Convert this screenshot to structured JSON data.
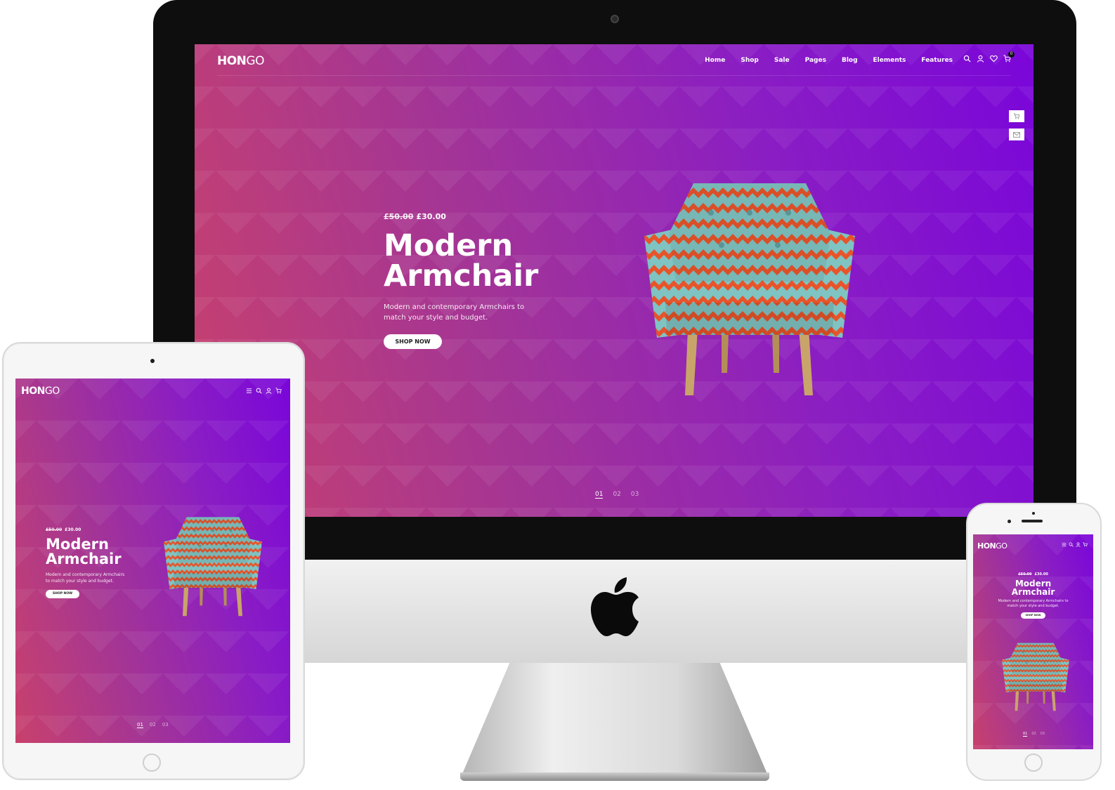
{
  "brand": {
    "logo_bold": "HON",
    "logo_light": "GO"
  },
  "nav": {
    "items": [
      "Home",
      "Shop",
      "Sale",
      "Pages",
      "Blog",
      "Elements",
      "Features"
    ],
    "cart_count": "0"
  },
  "hero": {
    "old_price": "£50.00",
    "new_price": "£30.00",
    "headline_line1": "Modern",
    "headline_line2": "Armchair",
    "description_line1": "Modern and contemporary Armchairs to",
    "description_line2": "match your style and budget.",
    "tablet_description_line1": "Modern and contemporary Armchairs",
    "tablet_description_line2": "to match your style and budget.",
    "phone_description_line1": "Modern and contemporary Armchairs to",
    "phone_description_line2": "match your style and budget.",
    "button_label": "SHOP NOW"
  },
  "slider": {
    "pages": [
      "01",
      "02",
      "03"
    ],
    "active": "01"
  },
  "icons": [
    "search-icon",
    "user-icon",
    "heart-icon",
    "cart-icon",
    "menu-icon",
    "mail-icon",
    "apple-logo-icon"
  ],
  "colors": {
    "gradient_start": "#c8416c",
    "gradient_mid": "#a43595",
    "gradient_end": "#7a06d9",
    "chair_orange": "#e8542a",
    "chair_teal": "#7fc3c2",
    "chair_legs": "#c9a46a"
  }
}
